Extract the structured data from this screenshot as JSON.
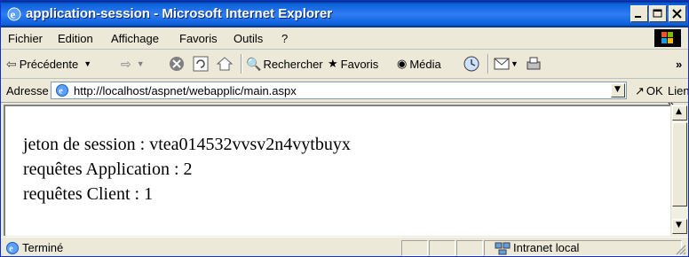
{
  "window": {
    "title": "application-session - Microsoft Internet Explorer",
    "minimize_icon": "minimize-icon",
    "maximize_icon": "maximize-icon",
    "close_icon": "close-icon"
  },
  "menu": {
    "items": [
      "Fichier",
      "Edition",
      "Affichage",
      "Favoris",
      "Outils",
      "?"
    ]
  },
  "toolbar": {
    "back_label": "Précédente",
    "search_label": "Rechercher",
    "favorites_label": "Favoris",
    "media_label": "Média",
    "overflow": "»"
  },
  "address": {
    "label": "Adresse",
    "url": "http://localhost/aspnet/webapplic/main.aspx",
    "ok_label": "OK",
    "links_label": "Liens »"
  },
  "content": {
    "lines": [
      "jeton de session : vtea014532vvsv2n4vytbuyx",
      "requêtes Application : 2",
      "requêtes Client : 1"
    ]
  },
  "status": {
    "text": "Terminé",
    "zone": "Intranet local"
  },
  "colors": {
    "titlebar": "#0a5fd8",
    "chrome": "#ece9d8"
  }
}
